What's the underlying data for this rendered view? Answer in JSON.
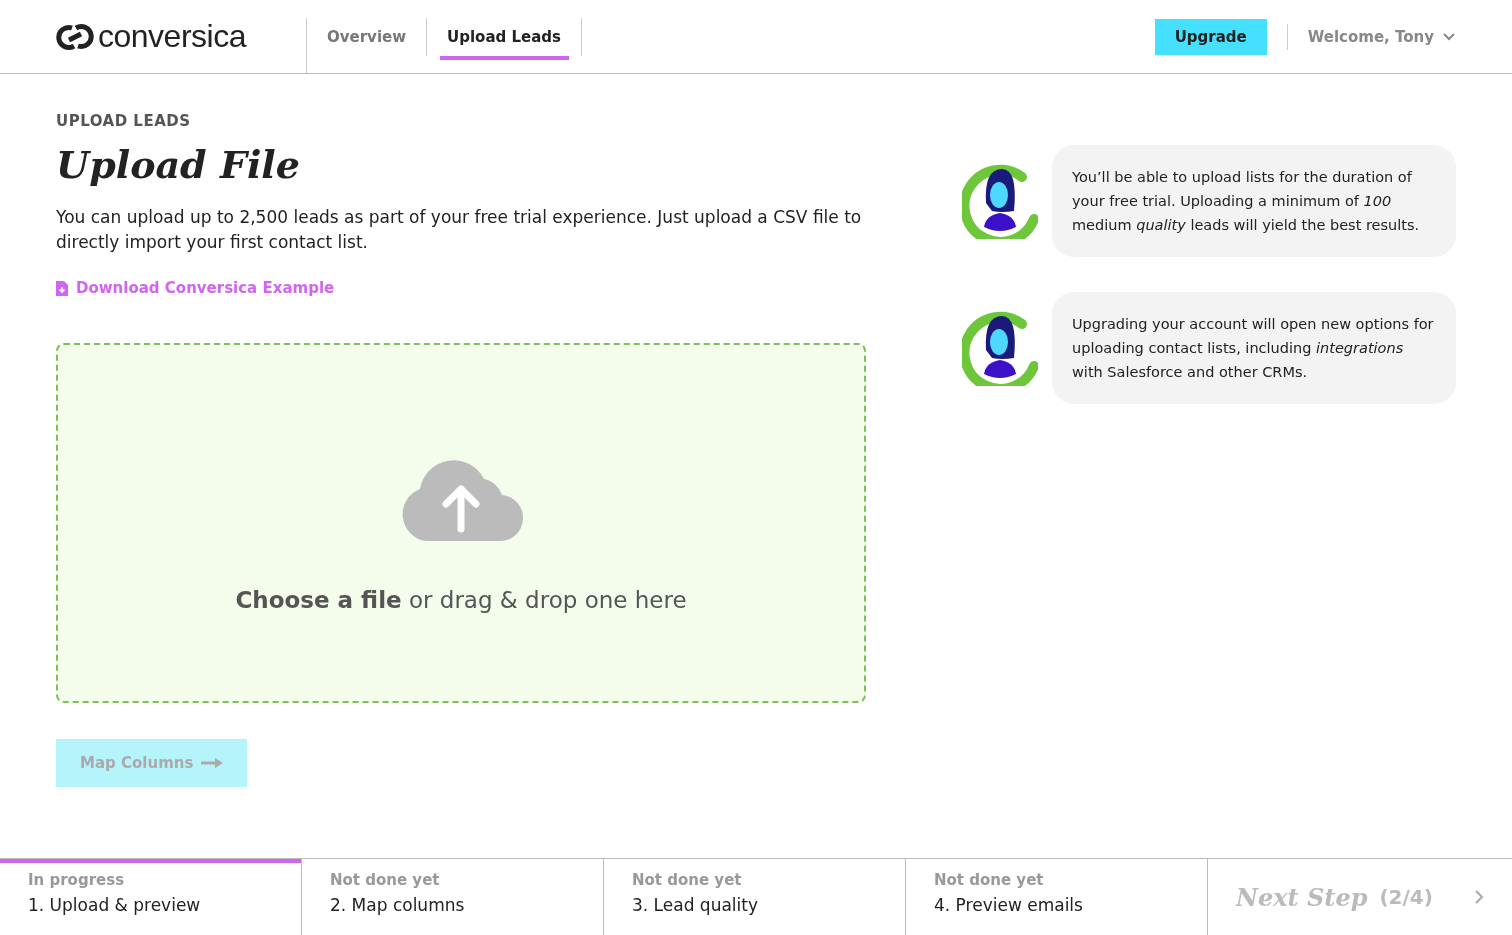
{
  "header": {
    "logo": "conversica",
    "nav": [
      {
        "label": "Overview",
        "selected": false
      },
      {
        "label": "Upload Leads",
        "selected": true
      }
    ],
    "upgrade": "Upgrade",
    "welcome": "Welcome, Tony"
  },
  "page": {
    "eyebrow": "UPLOAD LEADS",
    "title": "Upload File",
    "description": "You can upload up to 2,500 leads as part of your free trial experience. Just upload a CSV file to directly import your first contact list.",
    "download_link": "Download Conversica Example",
    "dropzone": "**Choose a file** or drag & drop one here",
    "next_button": {
      "label": "Map Columns",
      "disabled": true
    }
  },
  "tips": [
    "You’ll be able to upload lists for the duration of your free trial. Uploading a minimum of *100* medium *quality* leads will yield the best results.",
    "Upgrading your account will open new options for uploading contact lists, including *integrations* with Salesforce and other CRMs."
  ],
  "steps": [
    {
      "status": "In progress",
      "label": "1. Upload & preview",
      "selected": true
    },
    {
      "status": "Not done yet",
      "label": "2. Map columns",
      "selected": false
    },
    {
      "status": "Not done yet",
      "label": "3. Lead quality",
      "selected": false
    },
    {
      "status": "Not done yet",
      "label": "4. Preview emails",
      "selected": false
    }
  ],
  "next_step": {
    "label": "Next Step",
    "count": "(2/4)",
    "disabled": true
  }
}
